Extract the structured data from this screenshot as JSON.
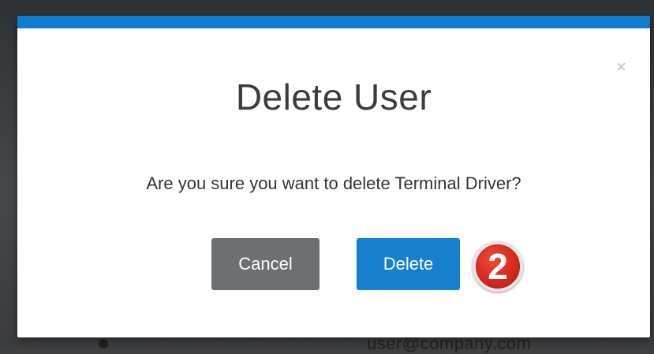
{
  "dialog": {
    "title": "Delete User",
    "close_glyph": "×",
    "message": "Are you sure you want to delete Terminal Driver?",
    "buttons": {
      "cancel_label": "Cancel",
      "delete_label": "Delete"
    }
  },
  "callout": {
    "step_number": "2"
  },
  "background": {
    "partial_text": "user@company.com"
  },
  "colors": {
    "header_accent": "#0f7ccf",
    "cancel_button": "#6d7073",
    "delete_button": "#1680cf",
    "badge": "#d42a1d"
  }
}
